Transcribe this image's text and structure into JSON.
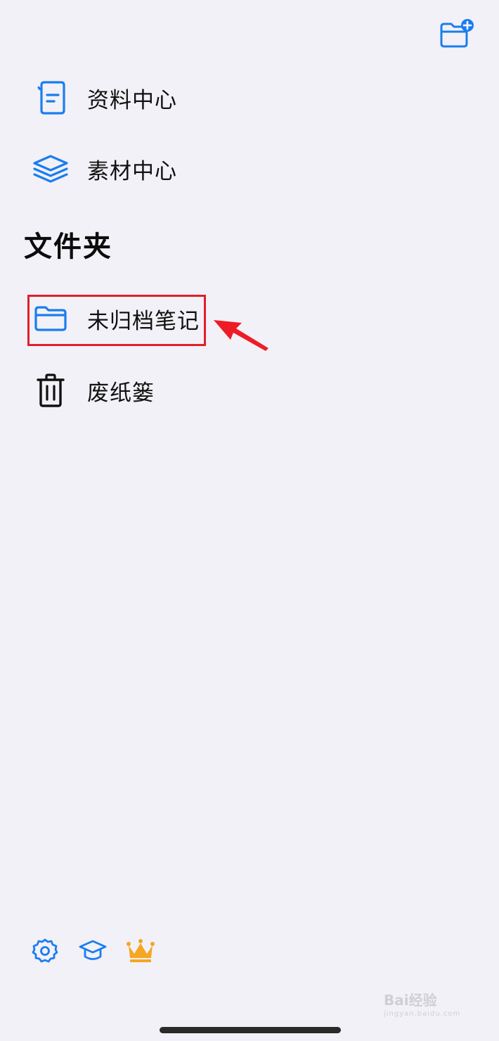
{
  "toolbar": {
    "new_folder_icon": "folder-plus-icon"
  },
  "nav": {
    "items": [
      {
        "label": "资料中心",
        "icon": "document-icon"
      },
      {
        "label": "素材中心",
        "icon": "layers-icon"
      }
    ]
  },
  "folders": {
    "title": "文件夹",
    "items": [
      {
        "label": "未归档笔记",
        "icon": "folder-icon",
        "highlighted": true
      },
      {
        "label": "废纸篓",
        "icon": "trash-icon"
      }
    ]
  },
  "bottom": {
    "icons": [
      "gear-icon",
      "graduation-cap-icon",
      "crown-icon"
    ]
  },
  "watermark": {
    "text": "Bai经验",
    "sub": "jingyan.baidu.com"
  },
  "colors": {
    "accent": "#1a7df0",
    "background": "#f2f1f7",
    "highlight": "#e0202a",
    "crown": "#f5a623"
  }
}
